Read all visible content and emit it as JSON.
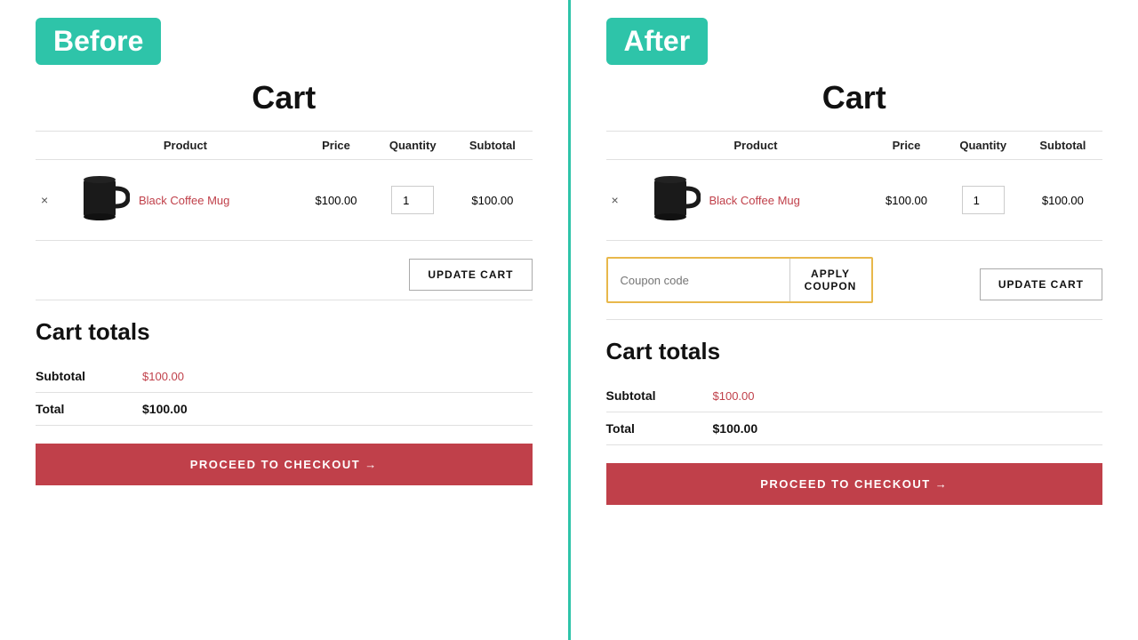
{
  "before": {
    "badge": "Before",
    "cart_title": "Cart",
    "table": {
      "headers": [
        "",
        "Product",
        "Price",
        "Quantity",
        "Subtotal"
      ],
      "row": {
        "remove": "×",
        "product_name": "Black Coffee Mug",
        "price": "$100.00",
        "qty": "1",
        "subtotal": "$100.00"
      }
    },
    "update_cart_label": "UPDATE CART",
    "cart_totals_title": "Cart totals",
    "subtotal_label": "Subtotal",
    "subtotal_value": "$100.00",
    "total_label": "Total",
    "total_value": "$100.00",
    "checkout_label": "PROCEED TO CHECKOUT →"
  },
  "after": {
    "badge": "After",
    "cart_title": "Cart",
    "table": {
      "headers": [
        "",
        "Product",
        "Price",
        "Quantity",
        "Subtotal"
      ],
      "row": {
        "remove": "×",
        "product_name": "Black Coffee Mug",
        "price": "$100.00",
        "qty": "1",
        "subtotal": "$100.00"
      }
    },
    "coupon_placeholder": "Coupon code",
    "apply_coupon_label": "APPLY COUPON",
    "update_cart_label": "UPDATE CART",
    "cart_totals_title": "Cart totals",
    "subtotal_label": "Subtotal",
    "subtotal_value": "$100.00",
    "total_label": "Total",
    "total_value": "$100.00",
    "checkout_label": "PROCEED TO CHECKOUT →"
  }
}
